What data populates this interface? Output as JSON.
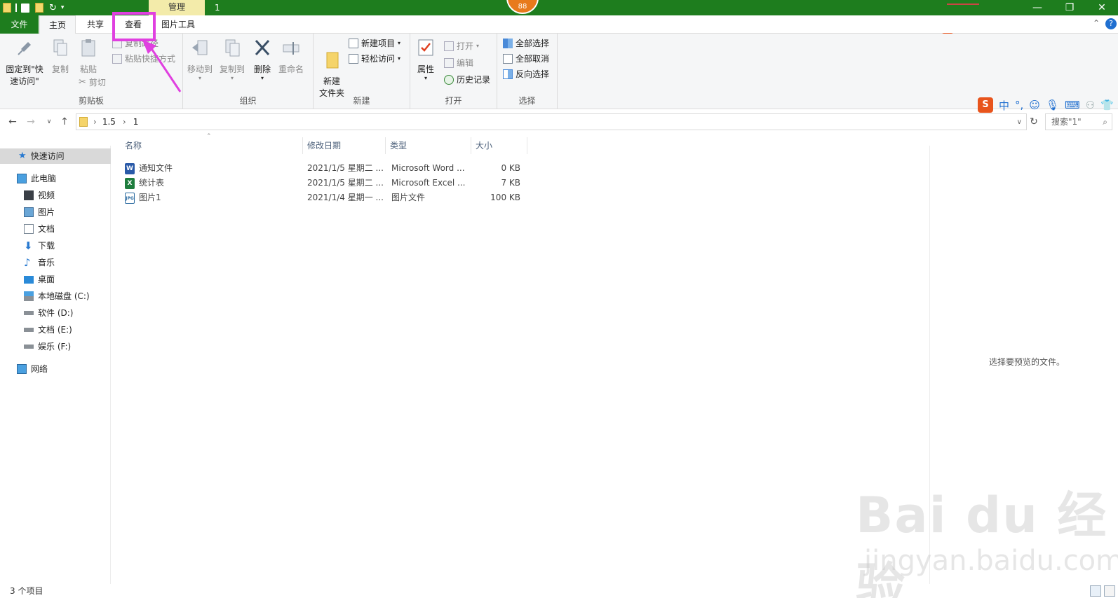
{
  "titlebar": {
    "context_tab": "管理",
    "window_title": "1",
    "badge": "88",
    "minimize": "—",
    "restore": "❐",
    "close": "✕"
  },
  "tabs": {
    "file": "文件",
    "home": "主页",
    "share": "共享",
    "view": "查看",
    "picture_tools": "图片工具"
  },
  "ribbon": {
    "clipboard": {
      "pin": "固定到\"快速访问\"",
      "copy": "复制",
      "paste": "粘贴",
      "copy_path": "复制路径",
      "paste_shortcut": "粘贴快捷方式",
      "cut": "剪切",
      "label": "剪贴板"
    },
    "organize": {
      "move_to": "移动到",
      "copy_to": "复制到",
      "delete": "删除",
      "rename": "重命名",
      "label": "组织"
    },
    "new": {
      "new_folder": "新建\n文件夹",
      "new_item": "新建项目",
      "easy_access": "轻松访问",
      "label": "新建"
    },
    "open": {
      "properties": "属性",
      "open": "打开",
      "edit": "编辑",
      "history": "历史记录",
      "label": "打开"
    },
    "select": {
      "select_all": "全部选择",
      "select_none": "全部取消",
      "invert": "反向选择",
      "label": "选择"
    }
  },
  "address": {
    "crumbs": [
      "1.5",
      "1"
    ],
    "search_placeholder": "搜索\"1\""
  },
  "ime": {
    "lang": "中",
    "punct": "°,"
  },
  "nav": {
    "quick_access": "快速访问",
    "this_pc": "此电脑",
    "videos": "视频",
    "pictures": "图片",
    "documents": "文档",
    "downloads": "下载",
    "music": "音乐",
    "desktop": "桌面",
    "disk_c": "本地磁盘 (C:)",
    "disk_d": "软件 (D:)",
    "disk_e": "文档 (E:)",
    "disk_f": "娱乐 (F:)",
    "network": "网络"
  },
  "columns": {
    "name": "名称",
    "modified": "修改日期",
    "type": "类型",
    "size": "大小"
  },
  "files": [
    {
      "name": "通知文件",
      "modified": "2021/1/5 星期二 ...",
      "type": "Microsoft Word ...",
      "size": "0 KB",
      "icon": "W"
    },
    {
      "name": "统计表",
      "modified": "2021/1/5 星期二 ...",
      "type": "Microsoft Excel ...",
      "size": "7 KB",
      "icon": "X"
    },
    {
      "name": "图片1",
      "modified": "2021/1/4 星期一 ...",
      "type": "图片文件",
      "size": "100 KB",
      "icon": "JPG"
    }
  ],
  "preview": {
    "text": "选择要预览的文件。"
  },
  "status": {
    "count": "3 个项目"
  },
  "watermark": {
    "brand": "Bai du 经验",
    "site": "jingyan.baidu.com"
  },
  "colors": {
    "titlebar": "#1e7d1e",
    "highlight": "#e040e0",
    "context_tab": "#f3ebaa"
  }
}
